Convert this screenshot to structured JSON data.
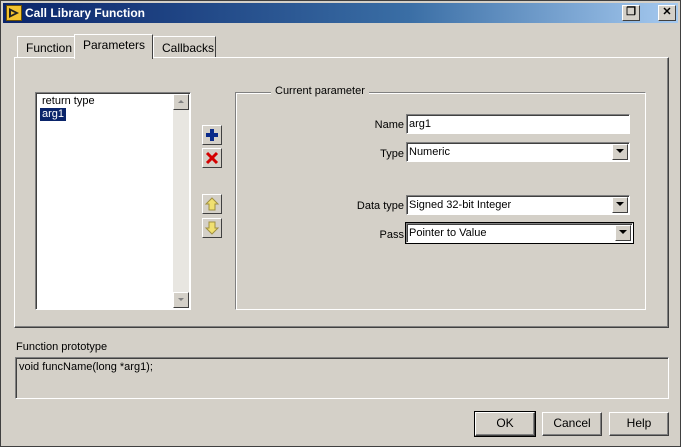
{
  "window": {
    "title": "Call Library Function",
    "restore_glyph": "❐",
    "close_glyph": "✕"
  },
  "tabs": [
    {
      "label": "Function",
      "active": false
    },
    {
      "label": "Parameters",
      "active": true
    },
    {
      "label": "Callbacks",
      "active": false
    }
  ],
  "parameters_list": {
    "items": [
      "return type",
      "arg1"
    ],
    "selected_index": 1
  },
  "list_buttons": {
    "add_icon": "plus-icon",
    "delete_icon": "red-x-icon",
    "move_up_icon": "arrow-up-icon",
    "move_down_icon": "arrow-down-icon"
  },
  "current_parameter": {
    "legend": "Current parameter",
    "name_label": "Name",
    "name_value": "arg1",
    "type_label": "Type",
    "type_value": "Numeric",
    "data_type_label": "Data type",
    "data_type_value": "Signed 32-bit Integer",
    "pass_label": "Pass",
    "pass_value": "Pointer to Value"
  },
  "prototype": {
    "label": "Function prototype",
    "text": "void funcName(long *arg1);"
  },
  "footer": {
    "ok_label": "OK",
    "cancel_label": "Cancel",
    "help_label": "Help"
  },
  "colors": {
    "face": "#d4d0c8",
    "titlebar_start": "#0a246a",
    "titlebar_end": "#a6caf0",
    "selection": "#0a246a",
    "delete_red": "#d40000",
    "add_blue": "#0a2a8a",
    "arrow_yellow": "#f0e070"
  }
}
